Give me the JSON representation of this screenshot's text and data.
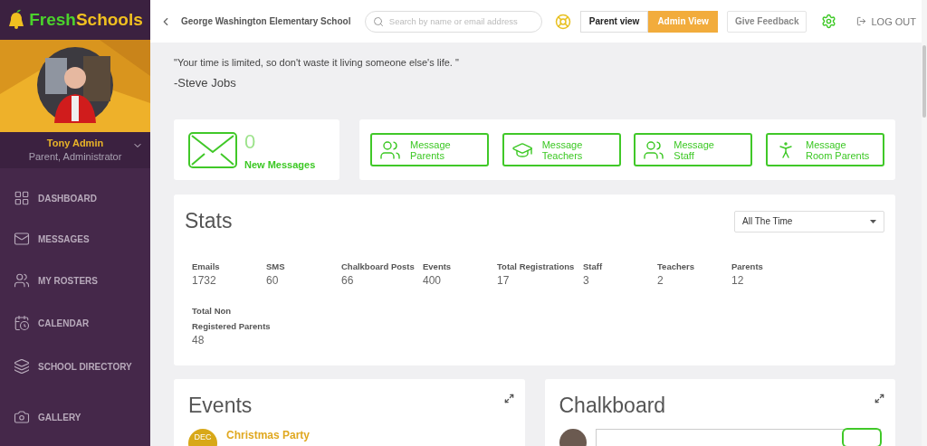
{
  "sidebar": {
    "logo": {
      "part1": "Fresh",
      "part2": "Schools"
    },
    "user": {
      "name": "Tony Admin",
      "role": "Parent, Administrator"
    },
    "items": [
      {
        "label": "DASHBOARD",
        "kind": "grid"
      },
      {
        "label": "MESSAGES",
        "kind": "mail"
      },
      {
        "label": "MY ROSTERS",
        "kind": "users"
      },
      {
        "label": "CALENDAR",
        "kind": "calendar"
      },
      {
        "label": "SCHOOL DIRECTORY",
        "kind": "layers"
      },
      {
        "label": "GALLERY",
        "kind": "camera"
      }
    ]
  },
  "header": {
    "school": "George Washington Elementary School",
    "search": {
      "placeholder": "Search by name or email address"
    },
    "views": [
      {
        "label": "Parent view",
        "selected": false
      },
      {
        "label": "Admin View",
        "selected": true
      }
    ],
    "feedback": "Give Feedback",
    "logout": "LOG OUT"
  },
  "quote": {
    "text": "\"Your time is limited, so don't waste it living someone else's life. \"",
    "author": "-Steve Jobs"
  },
  "messages": {
    "count": "0",
    "label": "New Messages"
  },
  "actions": [
    {
      "line1": "Message",
      "line2": "Parents",
      "kind": "parents"
    },
    {
      "line1": "Message",
      "line2": "Teachers",
      "kind": "teachers"
    },
    {
      "line1": "Message",
      "line2": "Staff",
      "kind": "staff"
    },
    {
      "line1": "Message",
      "line2": "Room Parents",
      "kind": "room"
    }
  ],
  "stats": {
    "title": "Stats",
    "range": "All The Time",
    "items": [
      {
        "label": "Emails",
        "value": "1732"
      },
      {
        "label": "SMS",
        "value": "60"
      },
      {
        "label": "Chalkboard Posts",
        "value": "66"
      },
      {
        "label": "Events",
        "value": "400"
      },
      {
        "label": "Total Registrations",
        "value": "17"
      },
      {
        "label": "Staff",
        "value": "3"
      },
      {
        "label": "Teachers",
        "value": "2"
      },
      {
        "label": "Parents",
        "value": "12"
      },
      {
        "label": "Total Non\nRegistered Parents",
        "value": "48"
      }
    ]
  },
  "events": {
    "title": "Events",
    "items": [
      {
        "month": "DEC",
        "title": "Christmas Party"
      }
    ]
  },
  "chalkboard": {
    "title": "Chalkboard"
  }
}
